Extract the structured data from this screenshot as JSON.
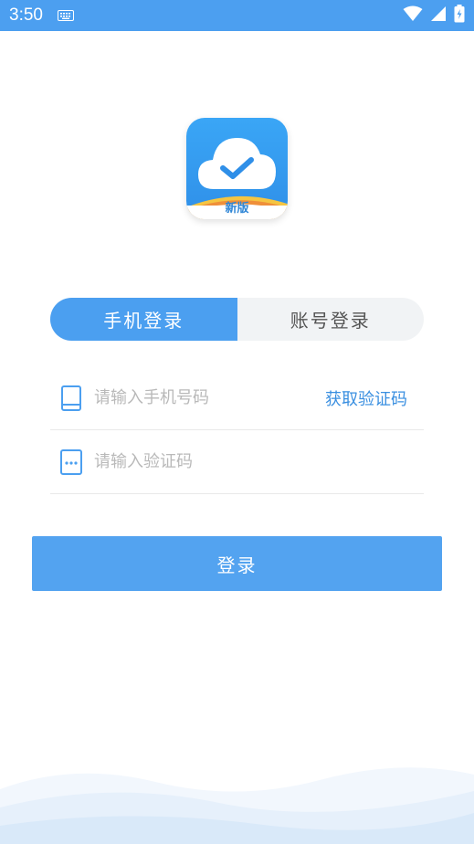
{
  "status_bar": {
    "time": "3:50",
    "icons": [
      "keyboard-icon",
      "wifi-icon",
      "signal-icon",
      "battery-icon"
    ],
    "background": "#4c9ff0"
  },
  "logo": {
    "label": "新版"
  },
  "tabs": [
    {
      "label": "手机登录",
      "active": true
    },
    {
      "label": "账号登录",
      "active": false
    }
  ],
  "phone_field": {
    "placeholder": "请输入手机号码",
    "value": "",
    "action": "获取验证码"
  },
  "code_field": {
    "placeholder": "请输入验证码",
    "value": ""
  },
  "login_button": {
    "label": "登录"
  },
  "colors": {
    "accent": "#4b9ff0",
    "link": "#3a8fe0"
  }
}
